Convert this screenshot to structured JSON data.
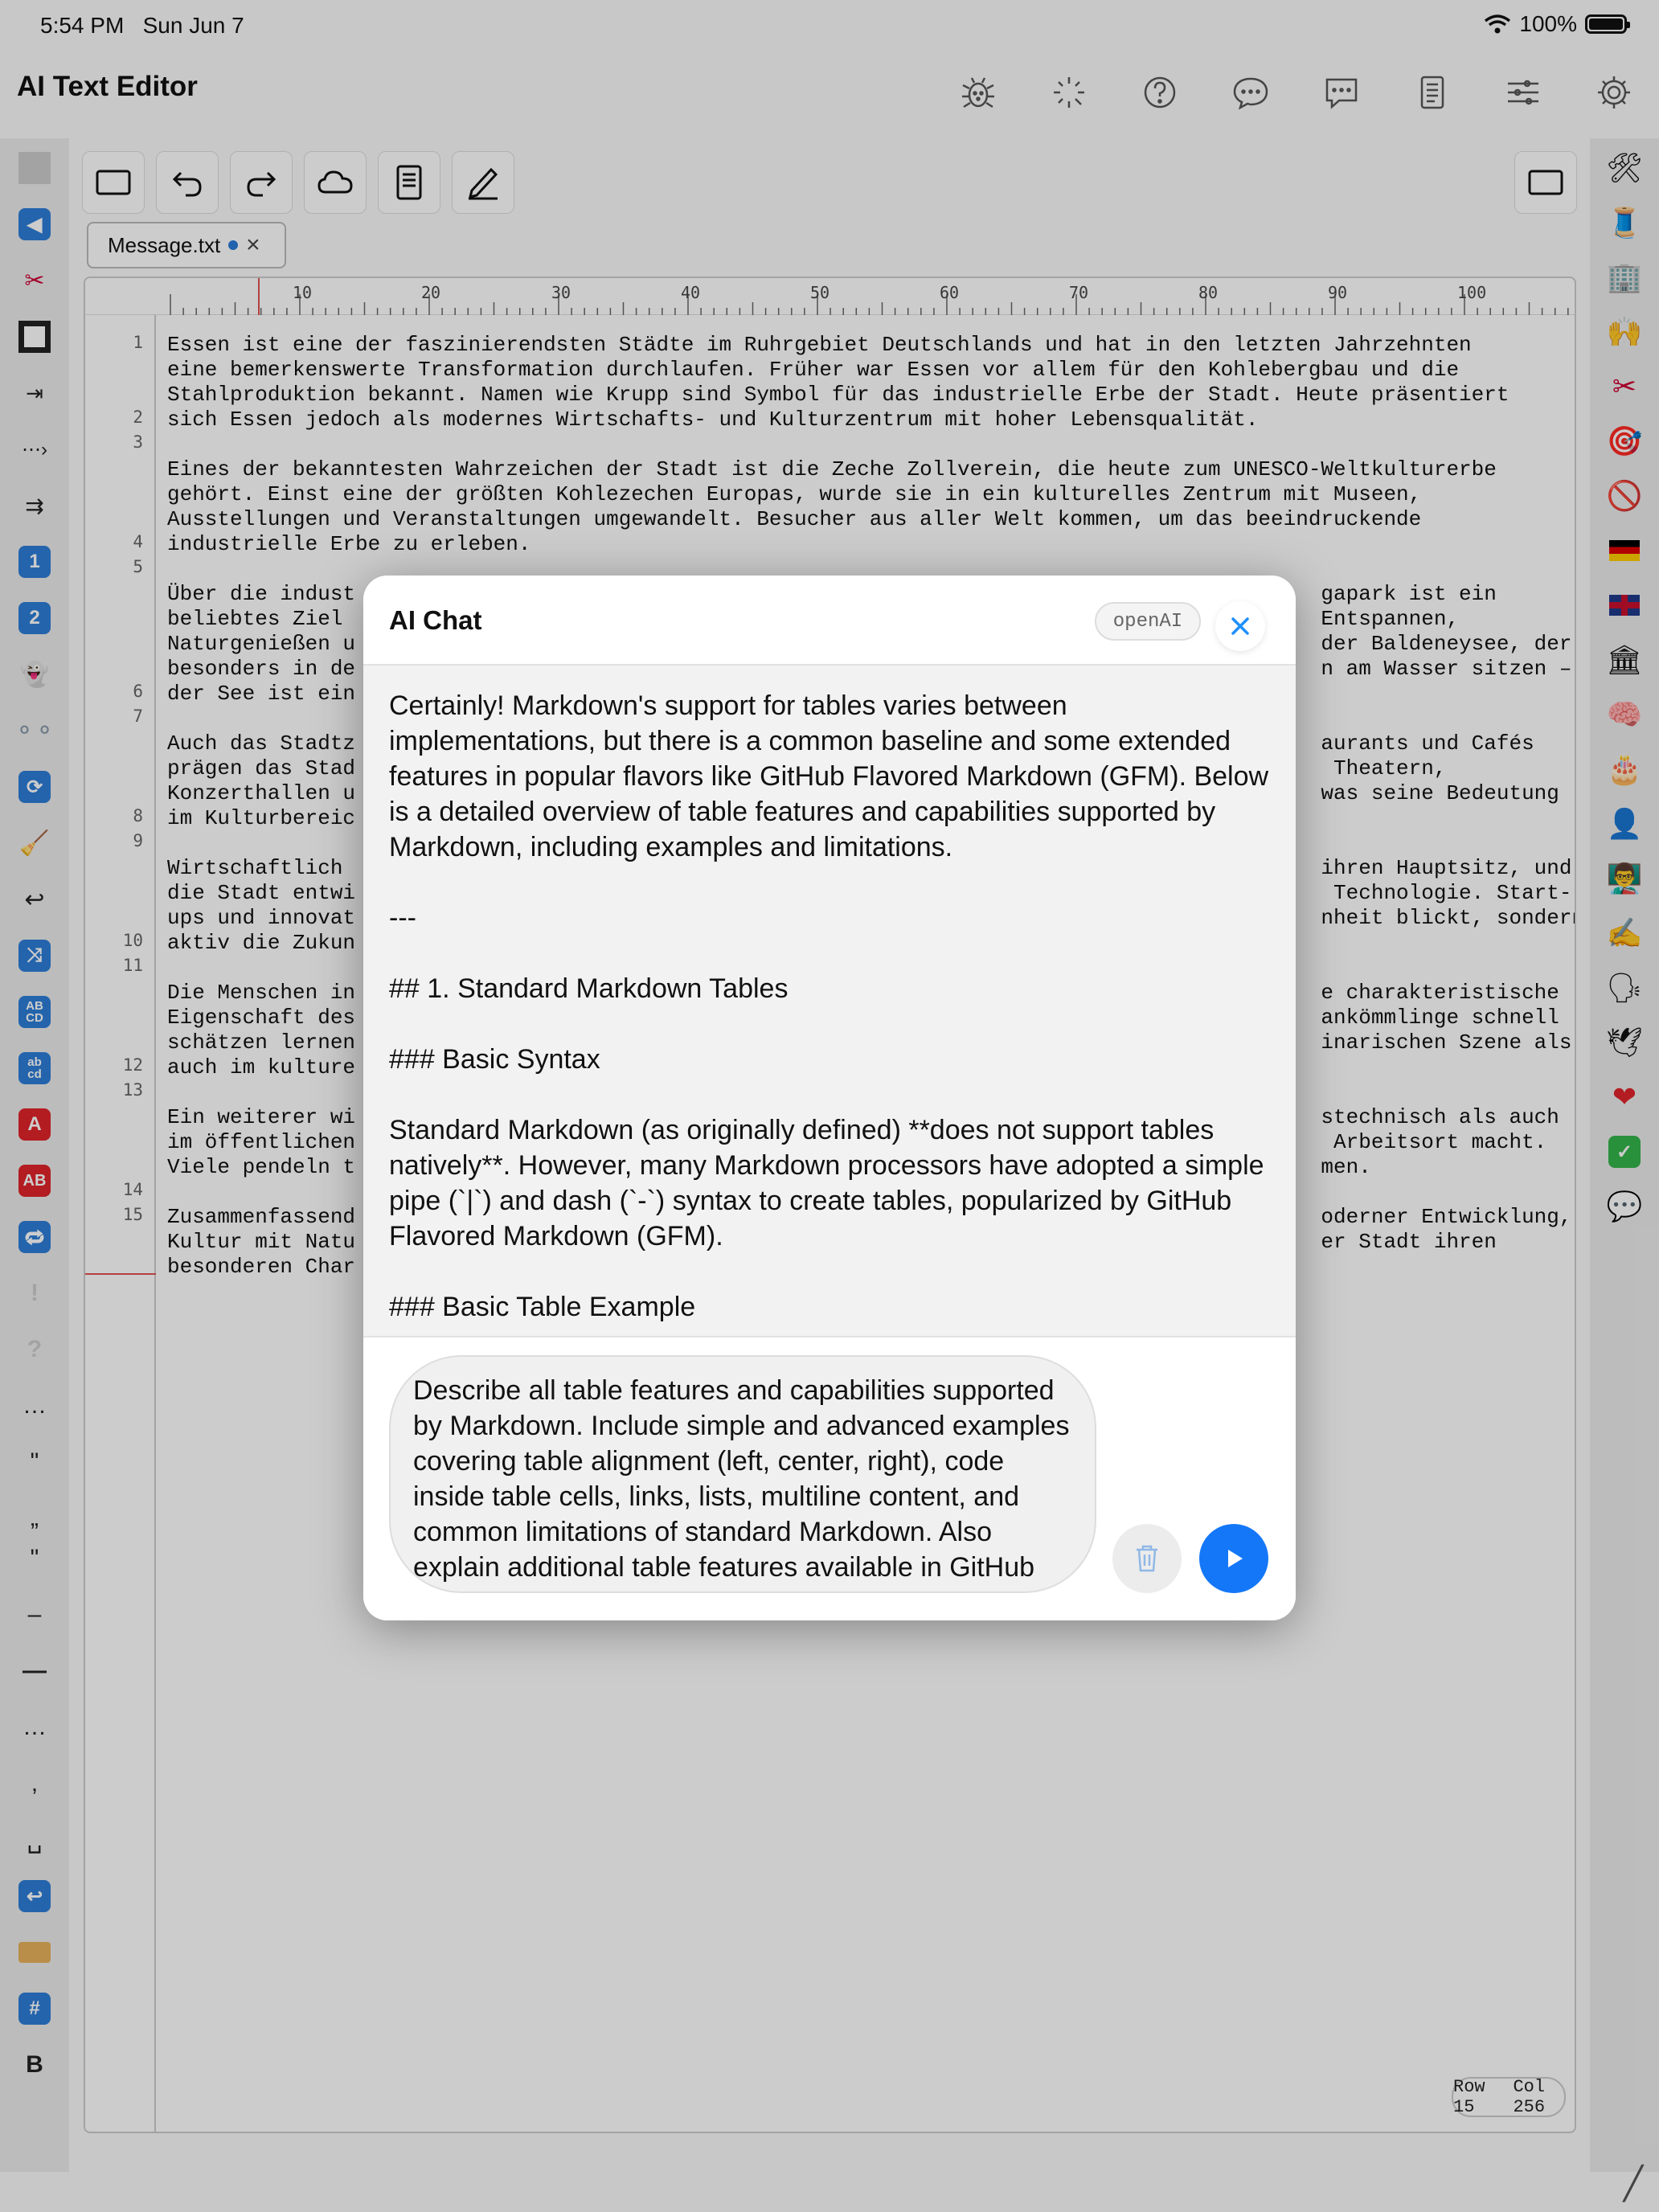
{
  "status_bar": {
    "time": "5:54 PM",
    "date": "Sun Jun 7",
    "battery": "100%",
    "wifi_icon": "wifi-icon"
  },
  "app": {
    "title": "AI Text Editor"
  },
  "nav_icons": [
    "bug-icon",
    "magic-wand-icon",
    "help-icon",
    "chat-bubble-icon",
    "message-icon",
    "document-icon",
    "sliders-icon",
    "gear-icon"
  ],
  "toolbar": {
    "buttons": [
      "rectangle-icon",
      "undo-icon",
      "redo-icon",
      "cloud-icon",
      "document-icon",
      "pencil-icon"
    ],
    "right_button": "rectangle-icon"
  },
  "tab": {
    "filename": "Message.txt",
    "close": "×"
  },
  "ruler": {
    "marks": [
      "10",
      "20",
      "30",
      "40",
      "50",
      "60",
      "70",
      "80",
      "90",
      "100"
    ]
  },
  "editor": {
    "line_numbers": [
      "1",
      "2",
      "3",
      "4",
      "5",
      "6",
      "7",
      "8",
      "9",
      "10",
      "11",
      "12",
      "13",
      "14",
      "15"
    ],
    "lines": [
      "Essen ist eine der faszinierendsten Städte im Ruhrgebiet Deutschlands und hat in den letzten Jahrzehnten",
      "eine bemerkenswerte Transformation durchlaufen. Früher war Essen vor allem für den Kohlebergbau und die",
      "Stahlproduktion bekannt. Namen wie Krupp sind Symbol für das industrielle Erbe der Stadt. Heute präsentiert",
      "sich Essen jedoch als modernes Wirtschafts- und Kulturzentrum mit hoher Lebensqualität.",
      "",
      "Eines der bekanntesten Wahrzeichen der Stadt ist die Zeche Zollverein, die heute zum UNESCO-Weltkulturerbe",
      "gehört. Einst eine der größten Kohlezechen Europas, wurde sie in ein kulturelles Zentrum mit Museen,",
      "Ausstellungen und Veranstaltungen umgewandelt. Besucher aus aller Welt kommen, um das beeindruckende",
      "industrielle Erbe zu erleben.",
      "",
      "Über die indust                                                                             gapark ist ein",
      "beliebtes Ziel                                                                              Entspannen,",
      "Naturgenießen u                                                                             der Baldeneysee, der",
      "besonders in de                                                                             n am Wasser sitzen –",
      "der See ist ein",
      "",
      "Auch das Stadtz                                                                             aurants und Cafés",
      "prägen das Stad                                                                              Theatern,",
      "Konzerthallen u                                                                             was seine Bedeutung",
      "im Kulturbereic",
      "",
      "Wirtschaftlich                                                                              ihren Hauptsitz, und",
      "die Stadt entwi                                                                              Technologie. Start-",
      "ups und innovat                                                                             nheit blickt, sondern",
      "aktiv die Zukun",
      "",
      "Die Menschen in                                                                             e charakteristische",
      "Eigenschaft des                                                                             ankömmlinge schnell",
      "schätzen lernen                                                                             inarischen Szene als",
      "auch im kulture",
      "",
      "Ein weiterer wi                                                                             stechnisch als auch",
      "im öffentlichen                                                                              Arbeitsort macht.",
      "Viele pendeln t                                                                             men.",
      "",
      "Zusammenfassend                                                                             oderner Entwicklung,",
      "Kultur mit Natu                                                                             er Stadt ihren",
      "besonderen Char"
    ],
    "row_label": "Row 15",
    "col_label": "Col 256"
  },
  "left_sidebar": [
    "gray-square-icon",
    "back-arrow-icon",
    "scissors-icon",
    "square-icon",
    "indent-icon",
    "ellipsis-arrow-icon",
    "double-arrow-icon",
    "keycap-1-icon",
    "keycap-2-icon",
    "ghost-icon",
    "circles-icon",
    "refresh-icon",
    "broom-icon",
    "return-icon",
    "shuffle-icon",
    "abcd-upper-icon",
    "abcd-lower-icon",
    "letter-a-icon",
    "ab-icon",
    "repeat-icon",
    "exclamation-icon",
    "question-icon",
    "ellipsis-icon",
    "quote-icon",
    "open-quote-icon",
    "close-quote-icon",
    "en-dash-icon",
    "em-dash-icon",
    "dots-icon",
    "comma-icon",
    "space-icon",
    "return-arrow-icon",
    "tag-icon",
    "hash-icon",
    "bold-icon"
  ],
  "right_sidebar": [
    "tools-icon",
    "thread-icon",
    "building-icon",
    "raised-hands-icon",
    "scissors-icon",
    "target-icon",
    "prohibited-icon",
    "german-flag-icon",
    "uk-flag-icon",
    "classical-building-icon",
    "brain-icon",
    "cake-icon",
    "person-icon",
    "teacher-icon",
    "writing-hand-icon",
    "speaking-head-icon",
    "dove-icon",
    "red-heart-icon",
    "check-mark-icon",
    "speech-bubble-icon"
  ],
  "chat": {
    "title": "AI Chat",
    "provider": "openAI",
    "response_paragraphs": [
      "Certainly! Markdown's support for tables varies between implementations, but there is a common baseline and some extended features in popular flavors like GitHub Flavored Markdown (GFM). Below is a detailed overview of table features and capabilities supported by Markdown, including examples and limitations.",
      "---",
      "## 1. Standard Markdown Tables",
      "### Basic Syntax",
      "Standard Markdown (as originally defined) **does not support tables natively**. However, many Markdown processors have adopted a simple pipe (`|`) and dash (`-`) syntax to create tables, popularized by GitHub Flavored Markdown (GFM).",
      "### Basic Table Example"
    ],
    "prompt": "Describe all table features and capabilities supported by Markdown. Include simple and advanced examples covering table alignment (left, center, right), code inside table cells, links, lists, multiline content, and common limitations of standard Markdown. Also explain additional table features available in GitHub"
  },
  "colors": {
    "accent": "#1477f8",
    "close_x": "#1e90ff",
    "modified_dot": "#2a7bd9"
  }
}
